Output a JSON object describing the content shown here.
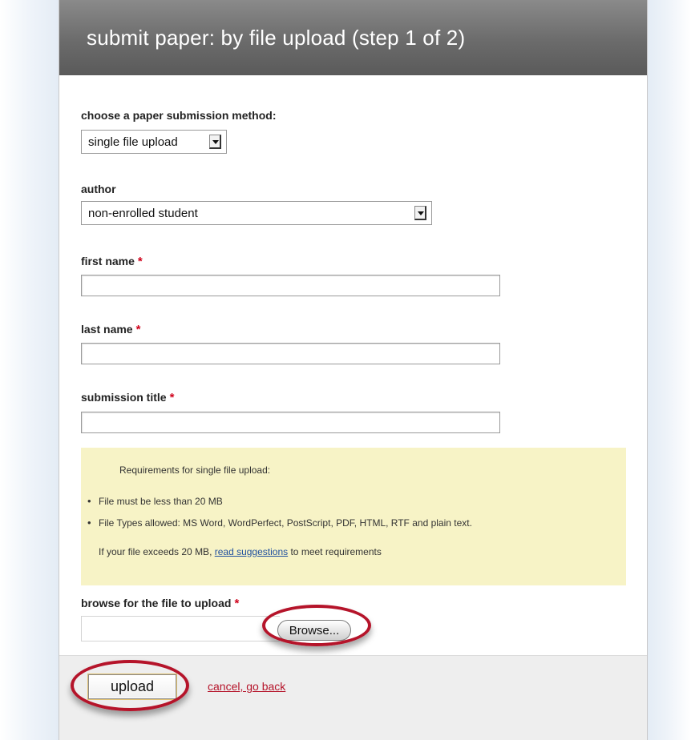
{
  "header": {
    "title": "submit paper: by file upload (step 1 of 2)"
  },
  "method": {
    "label": "choose a paper submission method:",
    "selected": "single file upload"
  },
  "author": {
    "label": "author",
    "selected": "non-enrolled student"
  },
  "first_name": {
    "label": "first name",
    "value": ""
  },
  "last_name": {
    "label": "last name",
    "value": ""
  },
  "submission_title": {
    "label": "submission title",
    "value": ""
  },
  "required_mark": "*",
  "requirements": {
    "intro": "Requirements for single file upload:",
    "items": [
      "File must be less than 20 MB",
      "File Types allowed: MS Word, WordPerfect, PostScript, PDF, HTML, RTF and plain text."
    ],
    "note_prefix": "If your file exceeds 20 MB, ",
    "note_link": "read suggestions",
    "note_suffix": " to meet requirements"
  },
  "browse": {
    "label": "browse for the file to upload",
    "button": "Browse..."
  },
  "footer": {
    "upload_label": "upload",
    "cancel_label": "cancel, go back"
  },
  "colors": {
    "header_bg": "#6b6b6b",
    "required": "#d0021b",
    "requirements_bg": "#f7f3c6",
    "highlight_ring": "#b5142a",
    "link": "#1f4f9e"
  }
}
